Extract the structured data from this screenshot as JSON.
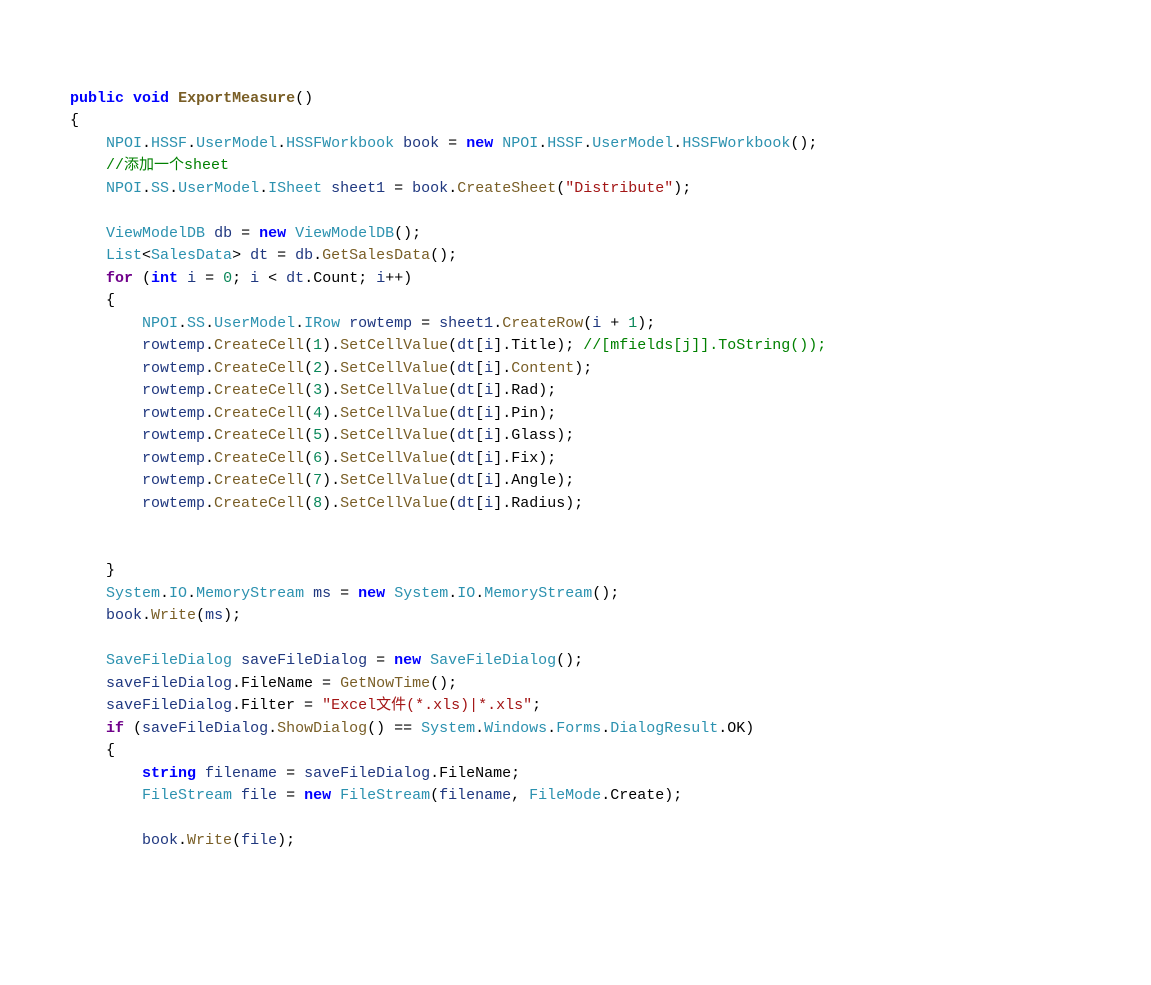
{
  "lines": [
    {
      "indent": 0,
      "tokens": [
        {
          "c": "k bold",
          "t": "public"
        },
        {
          "t": " "
        },
        {
          "c": "k bold",
          "t": "void"
        },
        {
          "t": " "
        },
        {
          "c": "m bold",
          "t": "ExportMeasure"
        },
        {
          "t": "()"
        }
      ]
    },
    {
      "indent": 0,
      "tokens": [
        {
          "t": "{"
        }
      ]
    },
    {
      "indent": 1,
      "tokens": [
        {
          "c": "t",
          "t": "NPOI"
        },
        {
          "t": "."
        },
        {
          "c": "t",
          "t": "HSSF"
        },
        {
          "t": "."
        },
        {
          "c": "t",
          "t": "UserModel"
        },
        {
          "t": "."
        },
        {
          "c": "t",
          "t": "HSSFWorkbook"
        },
        {
          "t": " "
        },
        {
          "c": "id",
          "t": "book"
        },
        {
          "t": " = "
        },
        {
          "c": "k bold",
          "t": "new"
        },
        {
          "t": " "
        },
        {
          "c": "t",
          "t": "NPOI"
        },
        {
          "t": "."
        },
        {
          "c": "t",
          "t": "HSSF"
        },
        {
          "t": "."
        },
        {
          "c": "t",
          "t": "UserModel"
        },
        {
          "t": "."
        },
        {
          "c": "t",
          "t": "HSSFWorkbook"
        },
        {
          "t": "();"
        }
      ]
    },
    {
      "indent": 1,
      "tokens": [
        {
          "c": "c",
          "t": "//添加一个sheet"
        }
      ]
    },
    {
      "indent": 1,
      "tokens": [
        {
          "c": "t",
          "t": "NPOI"
        },
        {
          "t": "."
        },
        {
          "c": "t",
          "t": "SS"
        },
        {
          "t": "."
        },
        {
          "c": "t",
          "t": "UserModel"
        },
        {
          "t": "."
        },
        {
          "c": "t",
          "t": "ISheet"
        },
        {
          "t": " "
        },
        {
          "c": "id",
          "t": "sheet1"
        },
        {
          "t": " = "
        },
        {
          "c": "id",
          "t": "book"
        },
        {
          "t": "."
        },
        {
          "c": "m",
          "t": "CreateSheet"
        },
        {
          "t": "("
        },
        {
          "c": "s",
          "t": "\"Distribute\""
        },
        {
          "t": ");"
        }
      ]
    },
    {
      "indent": 1,
      "tokens": [
        {
          "t": ""
        }
      ]
    },
    {
      "indent": 1,
      "tokens": [
        {
          "c": "t",
          "t": "ViewModelDB"
        },
        {
          "t": " "
        },
        {
          "c": "id",
          "t": "db"
        },
        {
          "t": " = "
        },
        {
          "c": "k bold",
          "t": "new"
        },
        {
          "t": " "
        },
        {
          "c": "t",
          "t": "ViewModelDB"
        },
        {
          "t": "();"
        }
      ]
    },
    {
      "indent": 1,
      "tokens": [
        {
          "c": "t",
          "t": "List"
        },
        {
          "t": "<"
        },
        {
          "c": "t",
          "t": "SalesData"
        },
        {
          "t": "> "
        },
        {
          "c": "id",
          "t": "dt"
        },
        {
          "t": " = "
        },
        {
          "c": "id",
          "t": "db"
        },
        {
          "t": "."
        },
        {
          "c": "m",
          "t": "GetSalesData"
        },
        {
          "t": "();"
        }
      ]
    },
    {
      "indent": 1,
      "tokens": [
        {
          "c": "p bold",
          "t": "for"
        },
        {
          "t": " ("
        },
        {
          "c": "k bold",
          "t": "int"
        },
        {
          "t": " "
        },
        {
          "c": "id",
          "t": "i"
        },
        {
          "t": " = "
        },
        {
          "c": "n",
          "t": "0"
        },
        {
          "t": "; "
        },
        {
          "c": "id",
          "t": "i"
        },
        {
          "t": " < "
        },
        {
          "c": "id",
          "t": "dt"
        },
        {
          "t": ".Count; "
        },
        {
          "c": "id",
          "t": "i"
        },
        {
          "t": "++)"
        }
      ]
    },
    {
      "indent": 1,
      "tokens": [
        {
          "t": "{"
        }
      ]
    },
    {
      "indent": 2,
      "tokens": [
        {
          "c": "t",
          "t": "NPOI"
        },
        {
          "t": "."
        },
        {
          "c": "t",
          "t": "SS"
        },
        {
          "t": "."
        },
        {
          "c": "t",
          "t": "UserModel"
        },
        {
          "t": "."
        },
        {
          "c": "t",
          "t": "IRow"
        },
        {
          "t": " "
        },
        {
          "c": "id",
          "t": "rowtemp"
        },
        {
          "t": " = "
        },
        {
          "c": "id",
          "t": "sheet1"
        },
        {
          "t": "."
        },
        {
          "c": "m",
          "t": "CreateRow"
        },
        {
          "t": "("
        },
        {
          "c": "id",
          "t": "i"
        },
        {
          "t": " + "
        },
        {
          "c": "n",
          "t": "1"
        },
        {
          "t": ");"
        }
      ]
    },
    {
      "indent": 2,
      "tokens": [
        {
          "c": "id",
          "t": "rowtemp"
        },
        {
          "t": "."
        },
        {
          "c": "m",
          "t": "CreateCell"
        },
        {
          "t": "("
        },
        {
          "c": "n",
          "t": "1"
        },
        {
          "t": ")."
        },
        {
          "c": "m",
          "t": "SetCellValue"
        },
        {
          "t": "("
        },
        {
          "c": "id",
          "t": "dt"
        },
        {
          "t": "["
        },
        {
          "c": "id",
          "t": "i"
        },
        {
          "t": "].Title); "
        },
        {
          "c": "c",
          "t": "//[mfields[j]].ToString());"
        }
      ]
    },
    {
      "indent": 2,
      "tokens": [
        {
          "c": "id",
          "t": "rowtemp"
        },
        {
          "t": "."
        },
        {
          "c": "m",
          "t": "CreateCell"
        },
        {
          "t": "("
        },
        {
          "c": "n",
          "t": "2"
        },
        {
          "t": ")."
        },
        {
          "c": "m",
          "t": "SetCellValue"
        },
        {
          "t": "("
        },
        {
          "c": "id",
          "t": "dt"
        },
        {
          "t": "["
        },
        {
          "c": "id",
          "t": "i"
        },
        {
          "t": "]."
        },
        {
          "c": "m",
          "t": "Content"
        },
        {
          "t": ");"
        }
      ]
    },
    {
      "indent": 2,
      "tokens": [
        {
          "c": "id",
          "t": "rowtemp"
        },
        {
          "t": "."
        },
        {
          "c": "m",
          "t": "CreateCell"
        },
        {
          "t": "("
        },
        {
          "c": "n",
          "t": "3"
        },
        {
          "t": ")."
        },
        {
          "c": "m",
          "t": "SetCellValue"
        },
        {
          "t": "("
        },
        {
          "c": "id",
          "t": "dt"
        },
        {
          "t": "["
        },
        {
          "c": "id",
          "t": "i"
        },
        {
          "t": "].Rad);"
        }
      ]
    },
    {
      "indent": 2,
      "tokens": [
        {
          "c": "id",
          "t": "rowtemp"
        },
        {
          "t": "."
        },
        {
          "c": "m",
          "t": "CreateCell"
        },
        {
          "t": "("
        },
        {
          "c": "n",
          "t": "4"
        },
        {
          "t": ")."
        },
        {
          "c": "m",
          "t": "SetCellValue"
        },
        {
          "t": "("
        },
        {
          "c": "id",
          "t": "dt"
        },
        {
          "t": "["
        },
        {
          "c": "id",
          "t": "i"
        },
        {
          "t": "].Pin);"
        }
      ]
    },
    {
      "indent": 2,
      "tokens": [
        {
          "c": "id",
          "t": "rowtemp"
        },
        {
          "t": "."
        },
        {
          "c": "m",
          "t": "CreateCell"
        },
        {
          "t": "("
        },
        {
          "c": "n",
          "t": "5"
        },
        {
          "t": ")."
        },
        {
          "c": "m",
          "t": "SetCellValue"
        },
        {
          "t": "("
        },
        {
          "c": "id",
          "t": "dt"
        },
        {
          "t": "["
        },
        {
          "c": "id",
          "t": "i"
        },
        {
          "t": "].Glass);"
        }
      ]
    },
    {
      "indent": 2,
      "tokens": [
        {
          "c": "id",
          "t": "rowtemp"
        },
        {
          "t": "."
        },
        {
          "c": "m",
          "t": "CreateCell"
        },
        {
          "t": "("
        },
        {
          "c": "n",
          "t": "6"
        },
        {
          "t": ")."
        },
        {
          "c": "m",
          "t": "SetCellValue"
        },
        {
          "t": "("
        },
        {
          "c": "id",
          "t": "dt"
        },
        {
          "t": "["
        },
        {
          "c": "id",
          "t": "i"
        },
        {
          "t": "].Fix);"
        }
      ]
    },
    {
      "indent": 2,
      "tokens": [
        {
          "c": "id",
          "t": "rowtemp"
        },
        {
          "t": "."
        },
        {
          "c": "m",
          "t": "CreateCell"
        },
        {
          "t": "("
        },
        {
          "c": "n",
          "t": "7"
        },
        {
          "t": ")."
        },
        {
          "c": "m",
          "t": "SetCellValue"
        },
        {
          "t": "("
        },
        {
          "c": "id",
          "t": "dt"
        },
        {
          "t": "["
        },
        {
          "c": "id",
          "t": "i"
        },
        {
          "t": "].Angle);"
        }
      ]
    },
    {
      "indent": 2,
      "tokens": [
        {
          "c": "id",
          "t": "rowtemp"
        },
        {
          "t": "."
        },
        {
          "c": "m",
          "t": "CreateCell"
        },
        {
          "t": "("
        },
        {
          "c": "n",
          "t": "8"
        },
        {
          "t": ")."
        },
        {
          "c": "m",
          "t": "SetCellValue"
        },
        {
          "t": "("
        },
        {
          "c": "id",
          "t": "dt"
        },
        {
          "t": "["
        },
        {
          "c": "id",
          "t": "i"
        },
        {
          "t": "].Radius);"
        }
      ]
    },
    {
      "indent": 2,
      "tokens": [
        {
          "t": ""
        }
      ]
    },
    {
      "indent": 2,
      "tokens": [
        {
          "t": ""
        }
      ]
    },
    {
      "indent": 1,
      "tokens": [
        {
          "t": "}"
        }
      ]
    },
    {
      "indent": 1,
      "tokens": [
        {
          "c": "t",
          "t": "System"
        },
        {
          "t": "."
        },
        {
          "c": "t",
          "t": "IO"
        },
        {
          "t": "."
        },
        {
          "c": "t",
          "t": "MemoryStream"
        },
        {
          "t": " "
        },
        {
          "c": "id",
          "t": "ms"
        },
        {
          "t": " = "
        },
        {
          "c": "k bold",
          "t": "new"
        },
        {
          "t": " "
        },
        {
          "c": "t",
          "t": "System"
        },
        {
          "t": "."
        },
        {
          "c": "t",
          "t": "IO"
        },
        {
          "t": "."
        },
        {
          "c": "t",
          "t": "MemoryStream"
        },
        {
          "t": "();"
        }
      ]
    },
    {
      "indent": 1,
      "tokens": [
        {
          "c": "id",
          "t": "book"
        },
        {
          "t": "."
        },
        {
          "c": "m",
          "t": "Write"
        },
        {
          "t": "("
        },
        {
          "c": "id",
          "t": "ms"
        },
        {
          "t": ");"
        }
      ]
    },
    {
      "indent": 1,
      "tokens": [
        {
          "t": ""
        }
      ]
    },
    {
      "indent": 1,
      "tokens": [
        {
          "c": "t",
          "t": "SaveFileDialog"
        },
        {
          "t": " "
        },
        {
          "c": "id",
          "t": "saveFileDialog"
        },
        {
          "t": " = "
        },
        {
          "c": "k bold",
          "t": "new"
        },
        {
          "t": " "
        },
        {
          "c": "t",
          "t": "SaveFileDialog"
        },
        {
          "t": "();"
        }
      ]
    },
    {
      "indent": 1,
      "tokens": [
        {
          "c": "id",
          "t": "saveFileDialog"
        },
        {
          "t": ".FileName = "
        },
        {
          "c": "m",
          "t": "GetNowTime"
        },
        {
          "t": "();"
        }
      ]
    },
    {
      "indent": 1,
      "tokens": [
        {
          "c": "id",
          "t": "saveFileDialog"
        },
        {
          "t": ".Filter = "
        },
        {
          "c": "s",
          "t": "\"Excel文件(*.xls)|*.xls\""
        },
        {
          "t": ";"
        }
      ]
    },
    {
      "indent": 1,
      "tokens": [
        {
          "c": "p bold",
          "t": "if"
        },
        {
          "t": " ("
        },
        {
          "c": "id",
          "t": "saveFileDialog"
        },
        {
          "t": "."
        },
        {
          "c": "m",
          "t": "ShowDialog"
        },
        {
          "t": "() == "
        },
        {
          "c": "t",
          "t": "System"
        },
        {
          "t": "."
        },
        {
          "c": "t",
          "t": "Windows"
        },
        {
          "t": "."
        },
        {
          "c": "t",
          "t": "Forms"
        },
        {
          "t": "."
        },
        {
          "c": "t",
          "t": "DialogResult"
        },
        {
          "t": ".OK)"
        }
      ]
    },
    {
      "indent": 1,
      "tokens": [
        {
          "t": "{"
        }
      ]
    },
    {
      "indent": 2,
      "tokens": [
        {
          "c": "k bold",
          "t": "string"
        },
        {
          "t": " "
        },
        {
          "c": "id",
          "t": "filename"
        },
        {
          "t": " = "
        },
        {
          "c": "id",
          "t": "saveFileDialog"
        },
        {
          "t": ".FileName;"
        }
      ]
    },
    {
      "indent": 2,
      "tokens": [
        {
          "c": "t",
          "t": "FileStream"
        },
        {
          "t": " "
        },
        {
          "c": "id",
          "t": "file"
        },
        {
          "t": " = "
        },
        {
          "c": "k bold",
          "t": "new"
        },
        {
          "t": " "
        },
        {
          "c": "t",
          "t": "FileStream"
        },
        {
          "t": "("
        },
        {
          "c": "id",
          "t": "filename"
        },
        {
          "t": ", "
        },
        {
          "c": "t",
          "t": "FileMode"
        },
        {
          "t": ".Create);"
        }
      ]
    },
    {
      "indent": 2,
      "tokens": [
        {
          "t": ""
        }
      ]
    },
    {
      "indent": 2,
      "tokens": [
        {
          "c": "id",
          "t": "book"
        },
        {
          "t": "."
        },
        {
          "c": "m",
          "t": "Write"
        },
        {
          "t": "("
        },
        {
          "c": "id",
          "t": "file"
        },
        {
          "t": ");"
        }
      ]
    }
  ]
}
